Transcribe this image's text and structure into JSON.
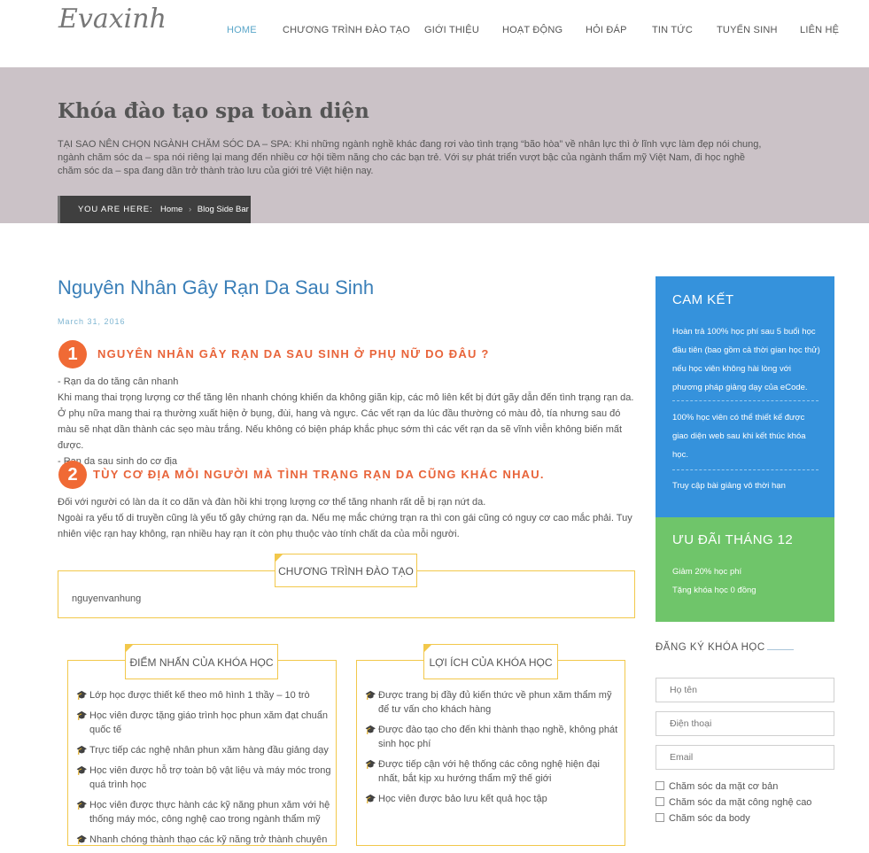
{
  "header": {
    "logo": "Evaxinh",
    "nav": [
      "HOME",
      "CHƯƠNG TRÌNH ĐÀO TẠO",
      "GIỚI THIỆU",
      "HOẠT ĐỘNG",
      "HỎI ĐÁP",
      "TIN TỨC",
      "TUYỂN SINH",
      "LIÊN HỆ"
    ]
  },
  "banner": {
    "title": "Khóa đào tạo spa toàn diện",
    "description": "TẠI SAO NÊN CHỌN NGÀNH CHĂM SÓC DA – SPA: Khi những ngành nghề khác đang rơi vào tình trạng “bão hòa” về nhân lực thì ở lĩnh vực làm đẹp nói chung, ngành chăm sóc da – spa nói riêng lại mang đến nhiều cơ hội tiềm năng cho các bạn trẻ. Với sự phát triển vượt bậc của ngành thẩm mỹ Việt Nam, đi học nghề chăm sóc da – spa đang dần trở thành trào lưu của giới trẻ Việt hiện nay.",
    "breadcrumb_label": "YOU ARE HERE:",
    "breadcrumb_home": "Home",
    "breadcrumb_current": "Blog Side Bar"
  },
  "post": {
    "title": "Nguyên Nhân Gây Rạn Da Sau Sinh",
    "date": "March 31, 2016",
    "section1_num": "1",
    "section1_title": "NGUYÊN NHÂN GÂY RẠN DA SAU SINH Ở PHỤ NỮ DO ĐÂU ?",
    "section1_lines": [
      "-  Rạn da do tăng cân nhanh",
      "Khi mang thai trọng lượng cơ thể tăng lên nhanh chóng  khiến da không giãn kịp, các mô liên kết bị đứt gãy dẫn đến tình trạng rạn da. Ở phụ nữa mang thai rạ thường xuất hiện ở bụng, đùi, hang và ngực. Các vết rạn da lúc đầu thường có màu đỏ, tía nhưng sau đó màu sẽ nhạt dần thành các sẹo màu trắng. Nếu không có biện pháp khắc phục sớm thì các vết rạn da sẽ vĩnh viễn không biến mất được.",
      "- Rạn da sau sinh do cơ địa"
    ],
    "section2_num": "2",
    "section2_title": "TÙY CƠ ĐỊA MỖI NGƯỜI MÀ TÌNH TRẠNG RẠN DA CŨNG KHÁC NHAU.",
    "section2_lines": [
      "Đối với người có làn da ít co dãn và đàn hồi khi trọng lượng cơ thể tăng nhanh rất dễ bị rạn nứt da.",
      "Ngoài ra yếu tố di truyền  cũng là yếu tố gây chứng rạn da. Nếu mẹ mắc chứng trạn ra thì con gái cũng có nguy cơ cao mắc phải. Tuy nhiên việc rạn hay không, rạn nhiều hay rạn ít còn phụ thuộc vào tính chất da của mỗi người."
    ]
  },
  "program_box": {
    "label": "CHƯƠNG TRÌNH ĐÀO TẠO",
    "text": "nguyenvanhung"
  },
  "highlights": {
    "label": "ĐIỂM NHẤN CỦA KHÓA HỌC",
    "items": [
      "Lớp học được thiết kế theo mô hình 1 thầy – 10 trò",
      "Học viên được tặng giáo trình học phun xăm đạt chuẩn quốc tế",
      "Trực tiếp các nghệ nhân phun xăm hàng đầu giảng dạy",
      "Học viên được hỗ trợ toàn bộ vật liệu và máy móc trong quá trình học",
      "Học viên được thực hành các kỹ năng phun xăm với hệ thống máy móc, công nghệ cao trong ngành thẩm mỹ",
      "Nhanh chóng thành thạo các kỹ năng trở thành chuyên"
    ]
  },
  "benefits": {
    "label": "LỢI ÍCH CỦA KHÓA HỌC",
    "items": [
      "Được trang bị đầy đủ kiến thức về phun xăm thẩm mỹ để tư vấn cho khách hàng",
      "Được đào tạo cho đến khi thành thạo nghề, không phát sinh học phí",
      "Được tiếp cận với hệ thống các công nghệ hiện đại nhất, bắt kịp xu hướng thẩm mỹ thế giới",
      "Học viên được bảo lưu kết quả học tập"
    ]
  },
  "sidebar": {
    "commit_title": "CAM KẾT",
    "commit_items": [
      "Hoàn trả 100% học phí sau 5 buổi học đầu tiên (bao gồm cả thời gian học thử) nếu học viên không hài lòng với phương pháp giảng dạy của eCode.",
      "100% học viên có thể thiết kế được giao diện web sau khi kết thúc khóa học.",
      "Truy cập bài giảng vô thời hạn"
    ],
    "offer_title": "ƯU ĐÃI THÁNG 12",
    "offer_items": [
      "Giảm 20% học phí",
      "Tặng khóa học 0 đồng"
    ],
    "register_title": "ĐĂNG KÝ KHÓA HỌC",
    "name_placeholder": "Họ tên",
    "phone_placeholder": "Điện thoại",
    "email_placeholder": "Email",
    "options": [
      "Chăm sóc da mặt cơ bản",
      "Chăm sóc da mặt công nghệ cao",
      "Chăm sóc da body"
    ]
  },
  "colors": {
    "accent_blue": "#3592dc",
    "accent_green": "#6fc56a",
    "orange": "#f06a35",
    "yellow_border": "#f2c84b",
    "banner_bg": "#cbc2c7"
  }
}
